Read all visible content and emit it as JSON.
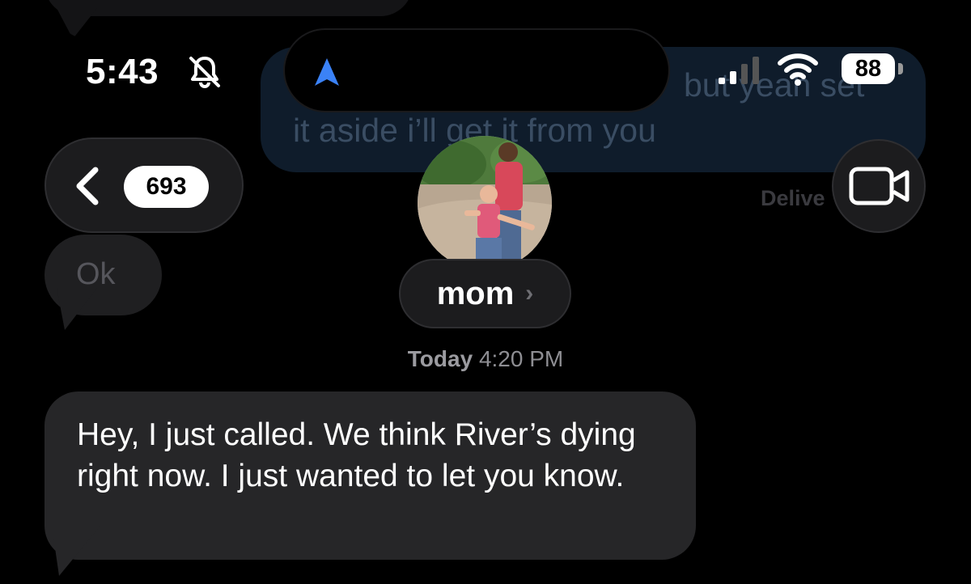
{
  "status_bar": {
    "time": "5:43",
    "battery": "88",
    "icons": [
      "bell-slash-icon",
      "location-arrow-icon",
      "signal-icon",
      "wifi-icon",
      "battery-icon"
    ]
  },
  "background_message": {
    "line1": "but yeah set",
    "line2": "it aside i’ll get it from you",
    "status": "Delive"
  },
  "nav": {
    "unread_count": "693",
    "back_icon": "chevron-left-icon",
    "video_icon": "video-camera-icon"
  },
  "contact": {
    "name": "mom",
    "chevron": "›"
  },
  "messages": {
    "ok": "Ok",
    "timestamp_day": "Today",
    "timestamp_time": "4:20 PM",
    "main": "Hey, I just called. We think River’s dying right now. I just wanted to let you know."
  },
  "colors": {
    "background": "#000000",
    "incoming_bubble": "#262628",
    "outgoing_bubble": "#0f1c2b",
    "accent_blue": "#3b82f6"
  }
}
